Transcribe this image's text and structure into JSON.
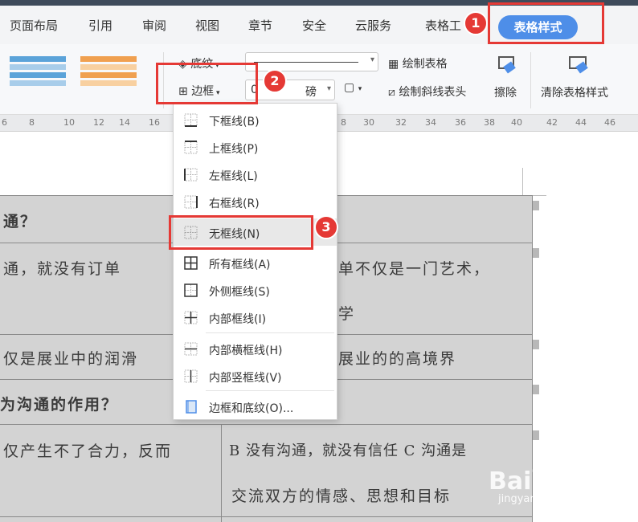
{
  "tabs": {
    "page_layout": "页面布局",
    "references": "引用",
    "review": "审阅",
    "view": "视图",
    "chapter": "章节",
    "security": "安全",
    "cloud": "云服务",
    "table_tools": "表格工",
    "table_style": "表格样式"
  },
  "ribbon": {
    "shading": "底纹",
    "border": "边框",
    "line_width_value": "0",
    "line_width_unit": "磅",
    "draw_table": "绘制表格",
    "draw_diagonal": "绘制斜线表头",
    "erase": "擦除",
    "clear_style": "清除表格样式"
  },
  "ruler": {
    "left_labels": [
      "6",
      "8",
      "10",
      "12",
      "14",
      "16"
    ],
    "right_labels": [
      "8",
      "30",
      "32",
      "34",
      "36",
      "38",
      "40",
      "42",
      "44",
      "46"
    ]
  },
  "border_menu": {
    "items": [
      {
        "label": "下框线(B)",
        "icon": "bottom-border-icon"
      },
      {
        "label": "上框线(P)",
        "icon": "top-border-icon"
      },
      {
        "label": "左框线(L)",
        "icon": "left-border-icon"
      },
      {
        "label": "右框线(R)",
        "icon": "right-border-icon"
      },
      {
        "label": "无框线(N)",
        "icon": "no-border-icon"
      },
      {
        "label": "所有框线(A)",
        "icon": "all-borders-icon"
      },
      {
        "label": "外侧框线(S)",
        "icon": "outside-borders-icon"
      },
      {
        "label": "内部框线(I)",
        "icon": "inside-borders-icon"
      },
      {
        "label": "内部横框线(H)",
        "icon": "inside-horizontal-border-icon"
      },
      {
        "label": "内部竖框线(V)",
        "icon": "inside-vertical-border-icon"
      },
      {
        "label": "边框和底纹(O)...",
        "icon": "borders-and-shading-icon"
      }
    ]
  },
  "document": {
    "row1": "通？",
    "row2_left": "通，就没有订单",
    "row2_right_1": "单不仅是一门艺术，",
    "row2_right_2": "学",
    "row3_left": "仅是展业中的润滑",
    "row3_right": "展业的的高境界",
    "row4": "为沟通的作用？",
    "row5_left": "仅产生不了合力，反而",
    "row5_right_1": "B 没有沟通，就没有信任 C 沟通是",
    "row5_right_2": "交流双方的情感、思想和目标"
  },
  "annotations": [
    "1",
    "2",
    "3"
  ],
  "watermark": {
    "logo": "Bai百经验",
    "url": "jingyan.baidu.com"
  },
  "colors": {
    "accent": "#4e8ee8",
    "annotation_red": "#e53935",
    "table_fill": "#d3d3d3"
  }
}
